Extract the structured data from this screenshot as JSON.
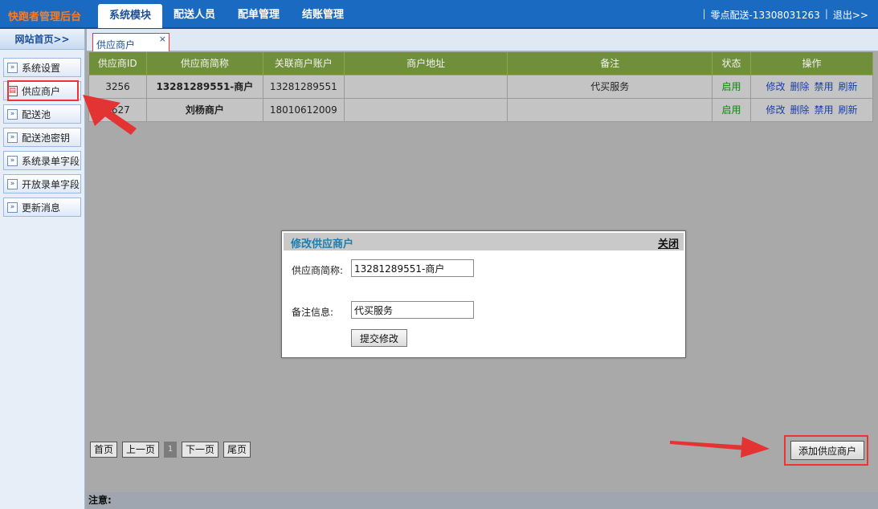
{
  "header": {
    "brand": "快跑者管理后台",
    "tabs": [
      {
        "label": "系统模块",
        "active": true
      },
      {
        "label": "配送人员",
        "active": false
      },
      {
        "label": "配单管理",
        "active": false
      },
      {
        "label": "结账管理",
        "active": false
      }
    ],
    "user_label": "零点配送-13308031263",
    "logout_label": "退出>>",
    "separator": "|"
  },
  "sidebar": {
    "home_label": "网站首页>>",
    "items": [
      {
        "label": "系统设置",
        "active": false
      },
      {
        "label": "供应商户",
        "active": true
      },
      {
        "label": "配送池",
        "active": false
      },
      {
        "label": "配送池密钥",
        "active": false
      },
      {
        "label": "系统录单字段",
        "active": false
      },
      {
        "label": "开放录单字段",
        "active": false
      },
      {
        "label": "更新消息",
        "active": false
      }
    ]
  },
  "content_tab": {
    "label": "供应商户",
    "close": "×"
  },
  "table": {
    "headers": [
      "供应商ID",
      "供应商简称",
      "关联商户账户",
      "商户地址",
      "备注",
      "状态",
      "操作"
    ],
    "rows": [
      {
        "id": "3256",
        "name": "13281289551-商户",
        "account": "13281289551",
        "address": "",
        "note": "代买服务",
        "status": "启用"
      },
      {
        "id": "2627",
        "name": "刘杨商户",
        "account": "18010612009",
        "address": "",
        "note": "",
        "status": "启用"
      }
    ],
    "actions": [
      "修改",
      "删除",
      "禁用",
      "刷新"
    ]
  },
  "modal": {
    "title": "修改供应商户",
    "close_label": "关闭",
    "name_label": "供应商简称:",
    "name_value": "13281289551-商户",
    "note_label": "备注信息:",
    "note_value": "代买服务",
    "submit_label": "提交修改"
  },
  "pager": {
    "first": "首页",
    "prev": "上一页",
    "current": "1",
    "next": "下一页",
    "last": "尾页"
  },
  "add_button_label": "添加供应商户",
  "notes_label": "注意:",
  "colors": {
    "topbar": "#1b6ac2",
    "brand": "#ff7a1a",
    "table_header": "#6f8f3a",
    "status_green": "#0a8a0a",
    "link_blue": "#1a3ea8",
    "highlight_red": "#e33333"
  },
  "icons": {
    "sidebar_item": "double-chevron-right-icon",
    "sidebar_item_active": "document-icon",
    "tab_close": "close-icon"
  }
}
